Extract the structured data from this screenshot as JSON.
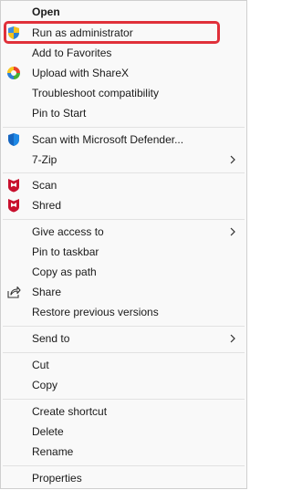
{
  "menu": {
    "items": [
      {
        "label": "Open"
      },
      {
        "label": "Run as administrator",
        "icon": "uac-shield-icon"
      },
      {
        "label": "Add to Favorites"
      },
      {
        "label": "Upload with ShareX",
        "icon": "sharex-icon"
      },
      {
        "label": "Troubleshoot compatibility"
      },
      {
        "label": "Pin to Start"
      },
      {
        "label": "Scan with Microsoft Defender...",
        "icon": "defender-shield-icon"
      },
      {
        "label": "7-Zip",
        "submenu": true
      },
      {
        "label": "Scan",
        "icon": "mcafee-icon"
      },
      {
        "label": "Shred",
        "icon": "mcafee-icon"
      },
      {
        "label": "Give access to",
        "submenu": true
      },
      {
        "label": "Pin to taskbar"
      },
      {
        "label": "Copy as path"
      },
      {
        "label": "Share",
        "icon": "share-icon"
      },
      {
        "label": "Restore previous versions"
      },
      {
        "label": "Send to",
        "submenu": true
      },
      {
        "label": "Cut"
      },
      {
        "label": "Copy"
      },
      {
        "label": "Create shortcut"
      },
      {
        "label": "Delete"
      },
      {
        "label": "Rename"
      },
      {
        "label": "Properties"
      }
    ]
  },
  "colors": {
    "highlight_border": "#e0303a",
    "uac_blue": "#2a7fd4",
    "uac_yellow": "#f5c21b",
    "defender_blue": "#1565c0",
    "mcafee_red": "#c8102e",
    "sharex_red": "#e8412c",
    "sharex_yellow": "#f8c620",
    "sharex_green": "#46b035",
    "sharex_blue": "#2f7fd6"
  }
}
